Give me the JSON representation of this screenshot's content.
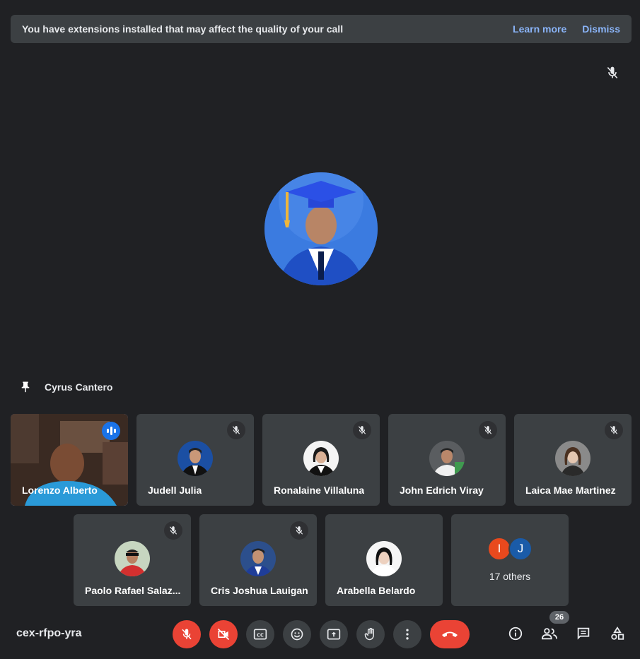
{
  "banner": {
    "text": "You have extensions installed that may affect the quality of your call",
    "learn_more": "Learn more",
    "dismiss": "Dismiss"
  },
  "pinned": {
    "name": "Cyrus Cantero"
  },
  "tiles_row1": [
    {
      "name": "Lorenzo Alberto",
      "speaking": true
    },
    {
      "name": "Judell Julia",
      "muted": true
    },
    {
      "name": "Ronalaine Villaluna",
      "muted": true
    },
    {
      "name": "John Edrich Viray",
      "muted": true
    },
    {
      "name": "Laica Mae Martinez",
      "muted": true
    }
  ],
  "tiles_row2": [
    {
      "name": "Paolo Rafael Salaz...",
      "muted": true
    },
    {
      "name": "Cris Joshua Lauigan",
      "muted": true
    },
    {
      "name": "Arabella Belardo"
    },
    {
      "name": "17 others",
      "initials": [
        "I",
        "J"
      ]
    }
  ],
  "meeting": {
    "code": "cex-rfpo-yra",
    "participant_count": "26"
  },
  "colors": {
    "accent": "#8ab4f8",
    "danger": "#ea4335",
    "surface": "#3c4043",
    "bg": "#202124"
  }
}
